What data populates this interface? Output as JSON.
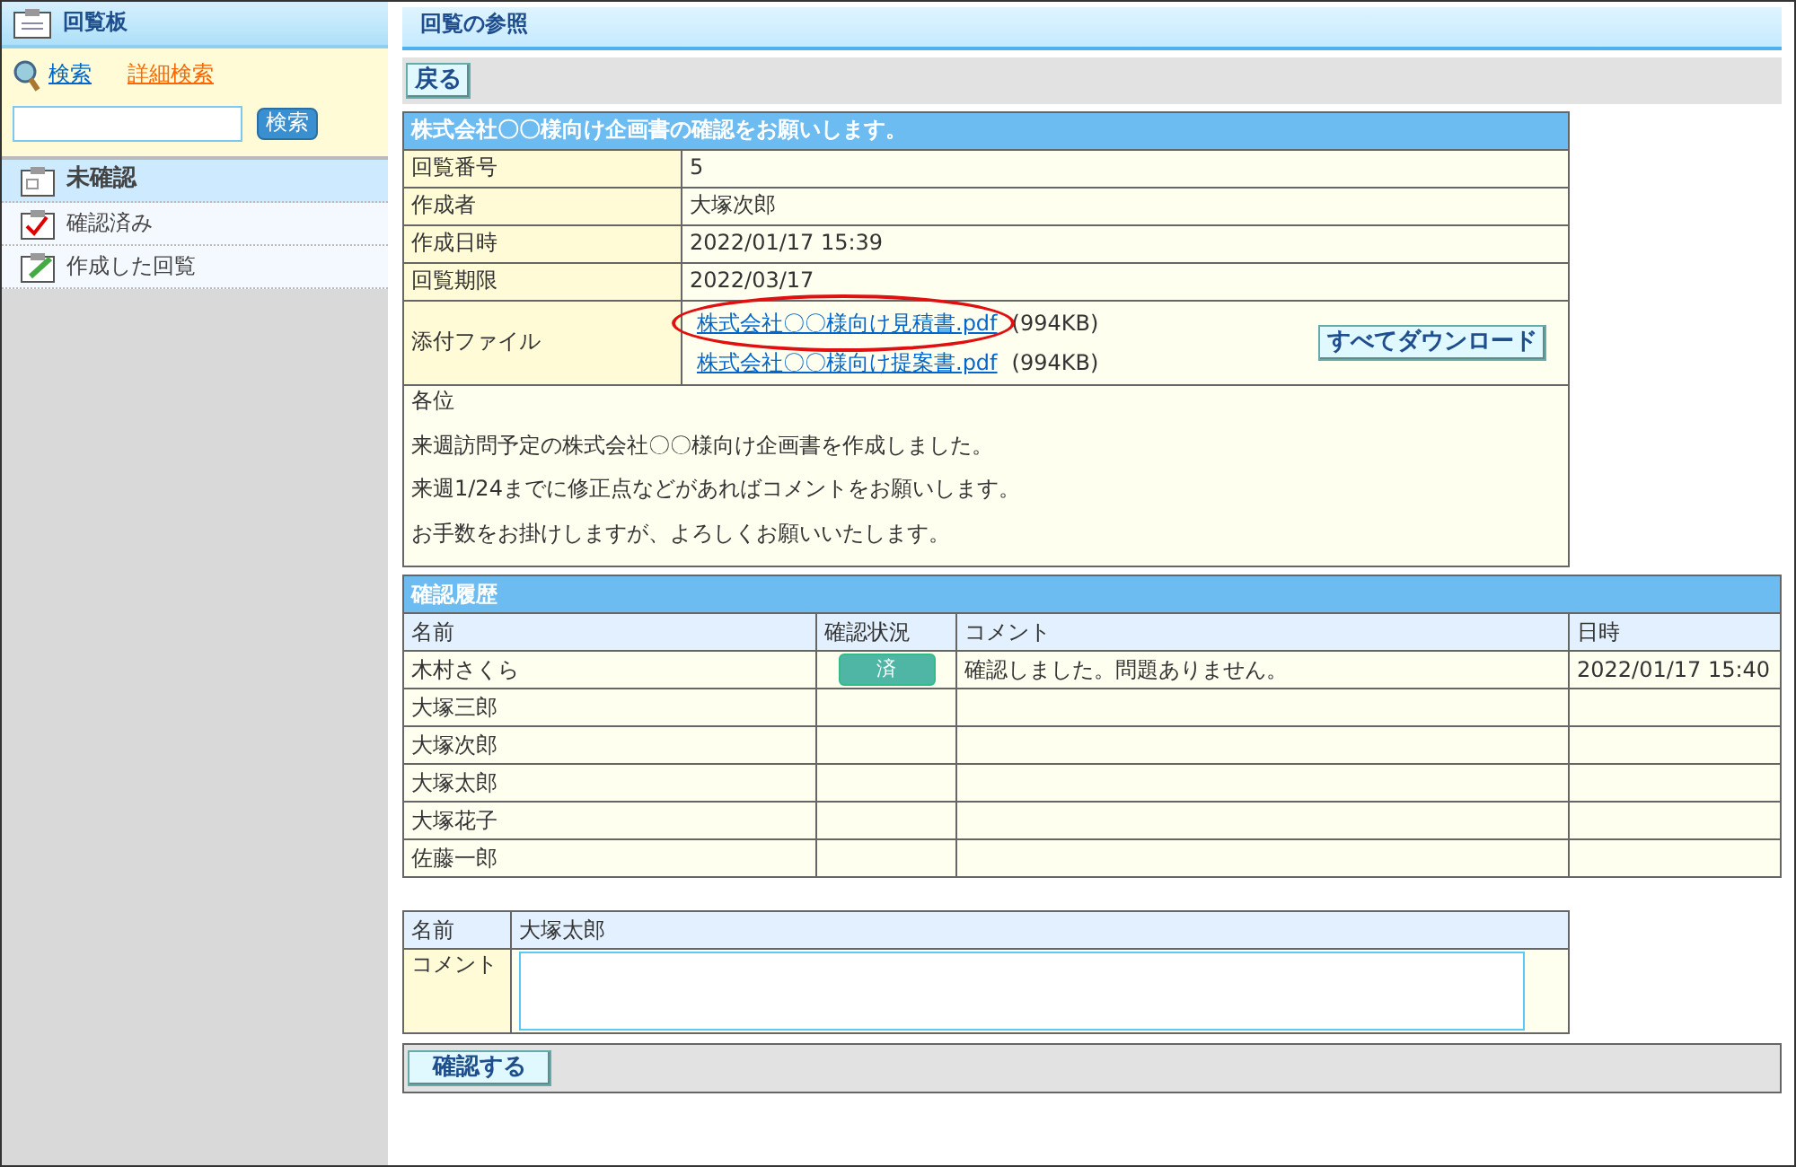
{
  "sidebar": {
    "title": "回覧板",
    "search_link": "検索",
    "advanced_search_link": "詳細検索",
    "search_button": "検索",
    "items": [
      {
        "label": "未確認",
        "selected": true,
        "kind": "unread"
      },
      {
        "label": "確認済み",
        "selected": false,
        "kind": "checked"
      },
      {
        "label": "作成した回覧",
        "selected": false,
        "kind": "created"
      }
    ]
  },
  "page_title": "回覧の参照",
  "back_button": "戻る",
  "circular": {
    "subject": "株式会社〇〇様向け企画書の確認をお願いします。",
    "fields": [
      {
        "label": "回覧番号",
        "value": "5"
      },
      {
        "label": "作成者",
        "value": "大塚次郎"
      },
      {
        "label": "作成日時",
        "value": "2022/01/17 15:39"
      },
      {
        "label": "回覧期限",
        "value": "2022/03/17"
      }
    ],
    "attachments_label": "添付ファイル",
    "attachments": [
      {
        "name": "株式会社〇〇様向け見積書.pdf",
        "size": "(994KB)",
        "highlighted": true
      },
      {
        "name": "株式会社〇〇様向け提案書.pdf",
        "size": "(994KB)",
        "highlighted": false
      }
    ],
    "download_all_button": "すべてダウンロード",
    "body": [
      "各位",
      "来週訪問予定の株式会社〇〇様向け企画書を作成しました。",
      "来週1/24までに修正点などがあればコメントをお願いします。",
      "お手数をお掛けしますが、よろしくお願いいたします。"
    ]
  },
  "history": {
    "title": "確認履歴",
    "columns": [
      "名前",
      "確認状況",
      "コメント",
      "日時"
    ],
    "rows": [
      {
        "name": "木村さくら",
        "status": "済",
        "comment": "確認しました。問題ありません。",
        "time": "2022/01/17 15:40"
      },
      {
        "name": "大塚三郎"
      },
      {
        "name": "大塚次郎"
      },
      {
        "name": "大塚太郎"
      },
      {
        "name": "大塚花子"
      },
      {
        "name": "佐藤一郎"
      }
    ]
  },
  "form": {
    "name_label": "名前",
    "name_value": "大塚太郎",
    "comment_label": "コメント",
    "submit_button": "確認する"
  }
}
